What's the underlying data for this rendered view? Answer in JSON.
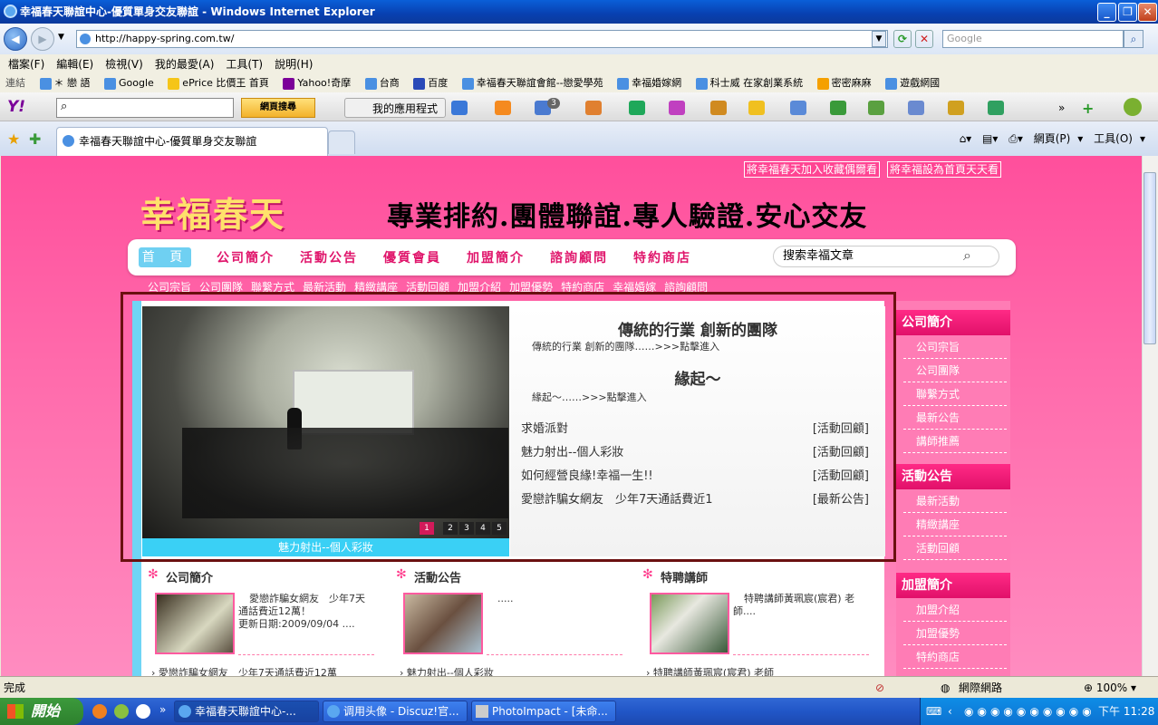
{
  "window": {
    "title": "幸福春天聯誼中心-優質單身交友聯誼 - Windows Internet Explorer"
  },
  "address": {
    "url": "http://happy-spring.com.tw/",
    "search_placeholder": "Google"
  },
  "menu": [
    "檔案(F)",
    "編輯(E)",
    "檢視(V)",
    "我的最愛(A)",
    "工具(T)",
    "說明(H)"
  ],
  "links": {
    "label": "連結",
    "items": [
      "＊ 戀 語",
      "Google",
      "ePrice 比價王 首頁",
      "Yahoo!奇摩",
      "台商",
      "百度",
      "幸福春天聯誼會館--戀愛學苑",
      "幸福婚嫁網",
      "科士威 在家創業系統",
      "密密麻麻",
      "遊戲網國"
    ]
  },
  "yahoo_toolbar": {
    "logo": "Y!",
    "search_button": "網頁搜尋",
    "my_apps": "我的應用程式",
    "mail_count": "3"
  },
  "tabs": {
    "active": "幸福春天聯誼中心-優質單身交友聯誼",
    "tools": [
      "網頁(P)",
      "工具(O)"
    ]
  },
  "site": {
    "top_links": [
      "將幸福春天加入收藏偶爾看",
      "將幸福設為首頁天天看"
    ],
    "logo": "幸福春天",
    "slogan": "專業排約.團體聯誼.專人驗證.安心交友",
    "nav": [
      "首 頁",
      "公司簡介",
      "活動公告",
      "優質會員",
      "加盟簡介",
      "諮詢顧問",
      "特約商店"
    ],
    "search_placeholder": "搜索幸福文章",
    "subnav": [
      "公司宗旨",
      "公司團隊",
      "聯繫方式",
      "最新活動",
      "精緻講座",
      "活動回顧",
      "加盟介紹",
      "加盟優勢",
      "特約商店",
      "幸福婚嫁",
      "諮詢顧問"
    ],
    "slideshow": {
      "caption": "魅力射出--個人彩妝",
      "pages": [
        "1",
        "2",
        "3",
        "4",
        "5"
      ],
      "active_page": "1"
    },
    "feature": [
      {
        "title": "傳統的行業 創新的團隊",
        "sub": "傳統的行業 創新的團隊……>>>點擊進入"
      },
      {
        "title": "緣起～",
        "sub": "緣起～……>>>點擊進入"
      }
    ],
    "news": [
      {
        "title": "求婚派對",
        "tag": "[活動回顧]"
      },
      {
        "title": "魅力射出--個人彩妝",
        "tag": "[活動回顧]"
      },
      {
        "title": "如何經營良緣!幸福一生!!",
        "tag": "[活動回顧]"
      },
      {
        "title": "愛戀詐騙女網友　少年7天通話費近1",
        "tag": "[最新公告]"
      }
    ],
    "sidebar": [
      {
        "head": "公司簡介",
        "items": [
          "公司宗旨",
          "公司團隊",
          "聯繫方式",
          "最新公告",
          "講師推薦"
        ]
      },
      {
        "head": "活動公告",
        "items": [
          "最新活動",
          "精緻講座",
          "活動回顧"
        ]
      },
      {
        "head": "加盟簡介",
        "items": [
          "加盟介紹",
          "加盟優勢",
          "特約商店"
        ]
      }
    ],
    "boxes": [
      {
        "title": "公司簡介",
        "text1": "愛戀詐騙女網友　少年7天",
        "text2": "通話費近12萬！",
        "text3": "更新日期:2009/09/04 ....",
        "link": "愛戀詐騙女網友　少年7天通話費近12萬"
      },
      {
        "title": "活動公告",
        "text1": ".....",
        "text2": "",
        "text3": "",
        "link": "魅力射出--個人彩妝"
      },
      {
        "title": "特聘講師",
        "text1": "特聘講師黃珮宸(宸君) 老",
        "text2": "師....",
        "text3": "",
        "link": "特聘講師黃珮宸(宸君) 老師"
      }
    ]
  },
  "status": {
    "text": "完成",
    "zone": "網際網路",
    "zoom": "100%"
  },
  "taskbar": {
    "start": "開始",
    "buttons": [
      "幸福春天聯誼中心-...",
      "调用头像 - Discuz!官...",
      "PhotoImpact - [未命..."
    ],
    "clock": "下午 11:28"
  },
  "colors": {
    "accent": "#ff3c8c",
    "nav_text": "#e0156b",
    "highlight": "#3ad0f5"
  }
}
